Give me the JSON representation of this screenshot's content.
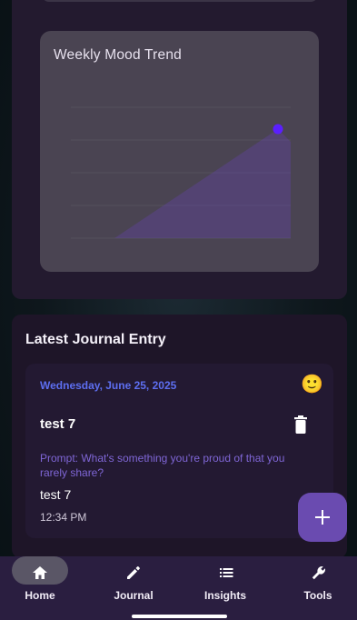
{
  "chart_data": {
    "type": "line",
    "title": "Weekly Mood Trend",
    "categories": [
      "",
      "",
      "",
      "",
      "",
      "",
      ""
    ],
    "series": [
      {
        "values": [
          null,
          null,
          null,
          null,
          null,
          null,
          5
        ]
      }
    ],
    "ylim": [
      0,
      6
    ],
    "point_color": "#5b1fff",
    "fill_color": "#6a3fc4"
  },
  "journal": {
    "section_title": "Latest Journal Entry",
    "entry": {
      "date": "Wednesday, June 25, 2025",
      "mood_emoji": "🙂",
      "title": "test 7",
      "prompt": "Prompt: What's something you're proud of that you rarely share?",
      "body": "test 7",
      "time": "12:34 PM"
    }
  },
  "fab": {
    "icon": "plus-icon"
  },
  "nav": {
    "items": [
      {
        "label": "Home",
        "icon": "home-icon",
        "active": true
      },
      {
        "label": "Journal",
        "icon": "pencil-icon",
        "active": false
      },
      {
        "label": "Insights",
        "icon": "list-icon",
        "active": false
      },
      {
        "label": "Tools",
        "icon": "wrench-icon",
        "active": false
      }
    ]
  },
  "colors": {
    "accent": "#6a4bb0",
    "date": "#5d6ef0",
    "prompt": "#7f66d6"
  }
}
